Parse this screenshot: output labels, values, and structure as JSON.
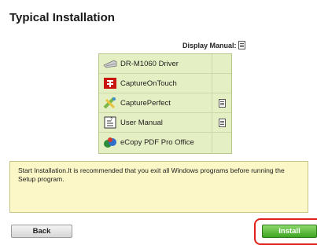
{
  "title": "Typical Installation",
  "display_manual_label": "Display Manual:",
  "items": [
    {
      "label": "DR-M1060 Driver",
      "icon": "scanner-icon",
      "manual": false
    },
    {
      "label": "CaptureOnTouch",
      "icon": "captureontouch-icon",
      "manual": false
    },
    {
      "label": "CapturePerfect",
      "icon": "captureperfect-icon",
      "manual": true
    },
    {
      "label": "User Manual",
      "icon": "manual-book-icon",
      "manual": true
    },
    {
      "label": "eCopy PDF Pro Office",
      "icon": "ecopy-icon",
      "manual": false
    }
  ],
  "message": "Start Installation.It is recommended that you exit all Windows programs before running the Setup program.",
  "buttons": {
    "back": "Back",
    "install": "Install"
  },
  "colors": {
    "list_bg": "#e4efc3",
    "message_bg": "#fbf7c6",
    "install": "#3fa524",
    "highlight": "#e0201a"
  }
}
